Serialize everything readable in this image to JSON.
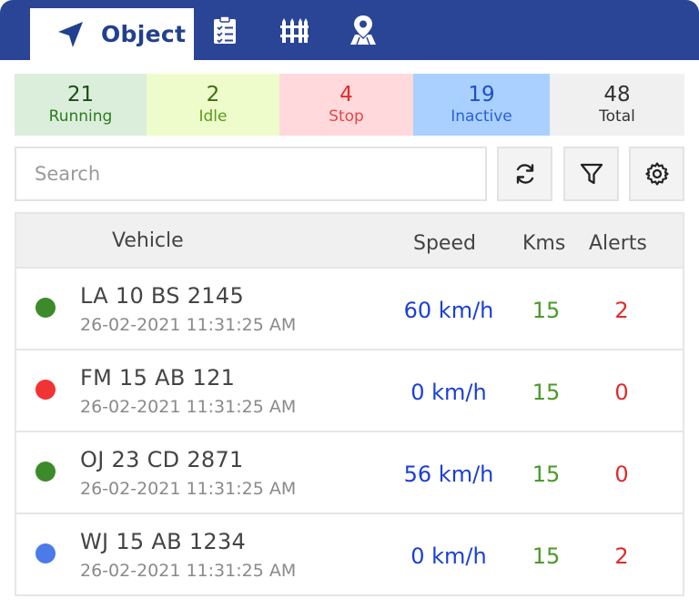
{
  "tabs": {
    "active_label": "Object",
    "items": [
      {
        "icon": "navigation-arrow-icon",
        "label": "Object"
      },
      {
        "icon": "clipboard-checklist-icon"
      },
      {
        "icon": "fence-icon"
      },
      {
        "icon": "map-pin-icon"
      }
    ]
  },
  "status": [
    {
      "count": "21",
      "label": "Running",
      "bg": "#dbeedc",
      "count_color": "#1b4d14",
      "label_color": "#2f7a1e"
    },
    {
      "count": "2",
      "label": "Idle",
      "bg": "#eefccc",
      "count_color": "#3d6e10",
      "label_color": "#5c9a1a"
    },
    {
      "count": "4",
      "label": "Stop",
      "bg": "#ffd9db",
      "count_color": "#e02b2b",
      "label_color": "#e04848"
    },
    {
      "count": "19",
      "label": "Inactive",
      "bg": "#a9d0ff",
      "count_color": "#1f4fc2",
      "label_color": "#2a5fd6"
    },
    {
      "count": "48",
      "label": "Total",
      "bg": "#f0f0f0",
      "count_color": "#333333",
      "label_color": "#333333"
    }
  ],
  "search": {
    "placeholder": "Search",
    "value": ""
  },
  "tools": [
    {
      "icon": "refresh-icon"
    },
    {
      "icon": "filter-icon"
    },
    {
      "icon": "settings-gear-icon"
    }
  ],
  "table": {
    "headers": {
      "vehicle": "Vehicle",
      "speed": "Speed",
      "kms": "Kms",
      "alerts": "Alerts"
    },
    "rows": [
      {
        "status_color": "#3d8a2a",
        "plate": "LA 10 BS 2145",
        "time": "26-02-2021 11:31:25 AM",
        "speed": "60 km/h",
        "kms": "15",
        "alerts": "2"
      },
      {
        "status_color": "#f23333",
        "plate": "FM 15 AB 121",
        "time": "26-02-2021 11:31:25 AM",
        "speed": "0 km/h",
        "kms": "15",
        "alerts": "0"
      },
      {
        "status_color": "#3d8a2a",
        "plate": "OJ 23 CD 2871",
        "time": "26-02-2021 11:31:25 AM",
        "speed": "56 km/h",
        "kms": "15",
        "alerts": "0"
      },
      {
        "status_color": "#4a7be8",
        "plate": "WJ 15 AB 1234",
        "time": "26-02-2021 11:31:25 AM",
        "speed": "0 km/h",
        "kms": "15",
        "alerts": "2"
      }
    ]
  },
  "colors": {
    "header_bg": "#2a4596",
    "tab_active_text": "#22408f"
  }
}
